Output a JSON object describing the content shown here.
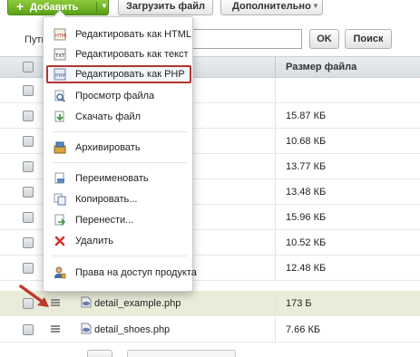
{
  "toolbar": {
    "add_label": "Добавить",
    "upload_label": "Загрузить файл",
    "more_label": "Дополнительно"
  },
  "path": {
    "label": "Путь",
    "value": "",
    "ok_label": "OK",
    "search_label": "Поиск"
  },
  "table": {
    "size_header": "Размер файла",
    "rows": [
      {
        "name": "",
        "size": ""
      },
      {
        "name": "",
        "size": "15.87 КБ"
      },
      {
        "name": "",
        "size": "10.68 КБ"
      },
      {
        "name": "",
        "size": "13.77 КБ"
      },
      {
        "name": "",
        "size": "13.48 КБ"
      },
      {
        "name": "",
        "size": "15.96 КБ"
      },
      {
        "name": "",
        "size": "10.52 КБ"
      },
      {
        "name": "",
        "size": "12.48 КБ"
      },
      {
        "name": "detail_example.php",
        "size": "173 Б",
        "highlighted": true
      },
      {
        "name": "detail_shoes.php",
        "size": "7.66 КБ"
      }
    ]
  },
  "context_menu": {
    "items": [
      {
        "label": "Редактировать как HTML",
        "icon": "html-edit-icon"
      },
      {
        "label": "Редактировать как текст",
        "icon": "text-edit-icon"
      },
      {
        "label": "Редактировать как PHP",
        "icon": "php-edit-icon",
        "active": true
      },
      {
        "label": "Просмотр файла",
        "icon": "view-file-icon"
      },
      {
        "label": "Скачать файл",
        "icon": "download-icon"
      },
      {
        "label": "Архивировать",
        "icon": "archive-icon"
      },
      {
        "label": "Переименовать",
        "icon": "rename-icon"
      },
      {
        "label": "Копировать...",
        "icon": "copy-icon"
      },
      {
        "label": "Перенести...",
        "icon": "move-icon"
      },
      {
        "label": "Удалить",
        "icon": "delete-icon"
      },
      {
        "label": "Права на доступ продукта",
        "icon": "access-rights-icon"
      }
    ]
  },
  "colors": {
    "accent_green": "#6ab42a",
    "highlight_border": "#b0352e",
    "highlight_row": "#e9ecd9",
    "arrow": "#c0392b"
  }
}
